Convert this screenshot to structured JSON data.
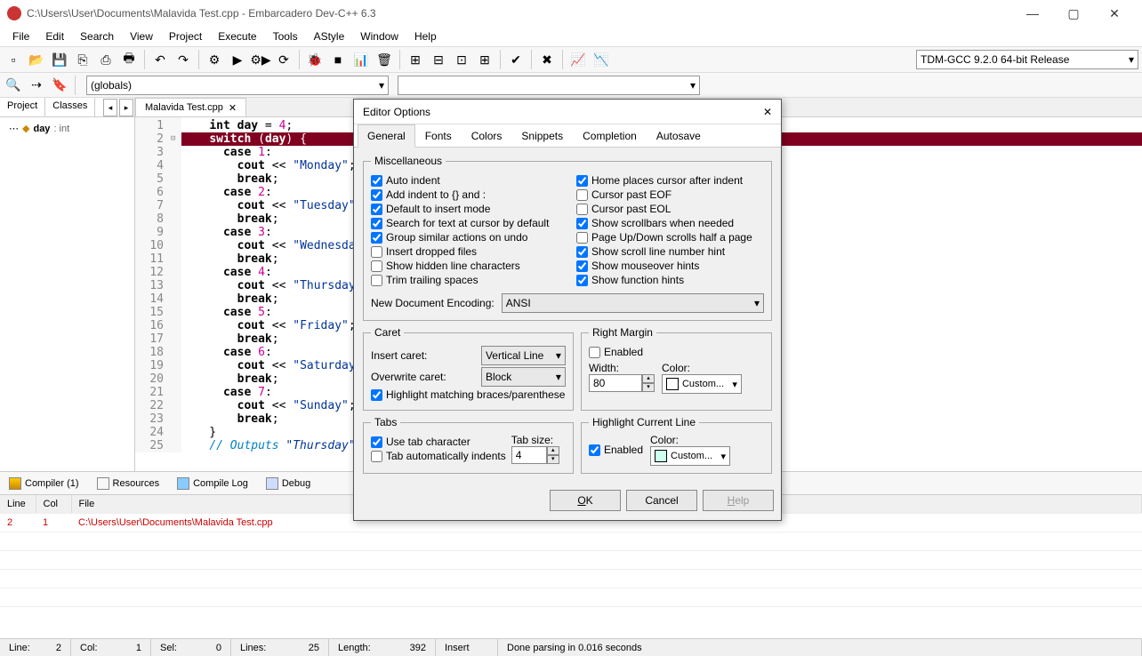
{
  "window": {
    "title": "C:\\Users\\User\\Documents\\Malavida Test.cpp - Embarcadero Dev-C++ 6.3"
  },
  "menu": [
    "File",
    "Edit",
    "Search",
    "View",
    "Project",
    "Execute",
    "Tools",
    "AStyle",
    "Window",
    "Help"
  ],
  "compiler_profile": "TDM-GCC 9.2.0 64-bit Release",
  "globals": "(globals)",
  "sidetabs": {
    "project": "Project",
    "classes": "Classes"
  },
  "tree": {
    "item": "day",
    "type": ": int"
  },
  "editor_tab": "Malavida Test.cpp",
  "code": {
    "lines": [
      1,
      2,
      3,
      4,
      5,
      6,
      7,
      8,
      9,
      10,
      11,
      12,
      13,
      14,
      15,
      16,
      17,
      18,
      19,
      20,
      21,
      22,
      23,
      24,
      25
    ],
    "l1": "    int day = 4;",
    "l2": "    switch (day) {",
    "l3": "      case 1:",
    "l4": "        cout << \"Monday\";",
    "l5": "        break;",
    "l6": "      case 2:",
    "l7": "        cout << \"Tuesday\";",
    "l8": "        break;",
    "l9": "      case 3:",
    "l10": "        cout << \"Wednesday\";",
    "l11": "        break;",
    "l12": "      case 4:",
    "l13": "        cout << \"Thursday\";",
    "l14": "        break;",
    "l15": "      case 5:",
    "l16": "        cout << \"Friday\";",
    "l17": "        break;",
    "l18": "      case 6:",
    "l19": "        cout << \"Saturday\";",
    "l20": "        break;",
    "l21": "      case 7:",
    "l22": "        cout << \"Sunday\";",
    "l23": "        break;",
    "l24": "    }",
    "l25": "    // Outputs \"Thursday\" (day"
  },
  "bottom": {
    "tabs": {
      "compiler": "Compiler (1)",
      "resources": "Resources",
      "compilelog": "Compile Log",
      "debug": "Debug"
    },
    "cols": {
      "line": "Line",
      "col": "Col",
      "file": "File"
    },
    "row": {
      "line": "2",
      "col": "1",
      "file": "C:\\Users\\User\\Documents\\Malavida Test.cpp"
    }
  },
  "status": {
    "line": "Line:",
    "line_v": "2",
    "col": "Col:",
    "col_v": "1",
    "sel": "Sel:",
    "sel_v": "0",
    "lines": "Lines:",
    "lines_v": "25",
    "len": "Length:",
    "len_v": "392",
    "mode": "Insert",
    "msg": "Done parsing in 0.016 seconds"
  },
  "dialog": {
    "title": "Editor Options",
    "tabs": [
      "General",
      "Fonts",
      "Colors",
      "Snippets",
      "Completion",
      "Autosave"
    ],
    "misc": {
      "legend": "Miscellaneous",
      "left": [
        "Auto indent",
        "Add indent to {} and :",
        "Default to insert mode",
        "Search for text at cursor by default",
        "Group similar actions on undo",
        "Insert dropped files",
        "Show hidden line characters",
        "Trim trailing spaces"
      ],
      "left_v": [
        true,
        true,
        true,
        true,
        true,
        false,
        false,
        false
      ],
      "right": [
        "Home places cursor after indent",
        "Cursor past EOF",
        "Cursor past EOL",
        "Show scrollbars when needed",
        "Page Up/Down scrolls half a page",
        "Show scroll line number hint",
        "Show mouseover hints",
        "Show function hints"
      ],
      "right_v": [
        true,
        false,
        false,
        true,
        false,
        true,
        true,
        true
      ],
      "enc_label": "New Document Encoding:",
      "enc_value": "ANSI"
    },
    "caret": {
      "legend": "Caret",
      "insert_l": "Insert caret:",
      "insert_v": "Vertical Line",
      "over_l": "Overwrite caret:",
      "over_v": "Block",
      "hl": "Highlight matching braces/parenthese",
      "hl_v": true
    },
    "rmargin": {
      "legend": "Right Margin",
      "enabled_l": "Enabled",
      "enabled_v": false,
      "width_l": "Width:",
      "width_v": "80",
      "color_l": "Color:",
      "color_v": "Custom..."
    },
    "tabs_grp": {
      "legend": "Tabs",
      "use_l": "Use tab character",
      "use_v": true,
      "auto_l": "Tab automatically indents",
      "auto_v": false,
      "size_l": "Tab size:",
      "size_v": "4"
    },
    "hlline": {
      "legend": "Highlight Current Line",
      "enabled_l": "Enabled",
      "enabled_v": true,
      "color_l": "Color:",
      "color_v": "Custom..."
    },
    "buttons": {
      "ok": "OK",
      "cancel": "Cancel",
      "help": "Help"
    }
  }
}
